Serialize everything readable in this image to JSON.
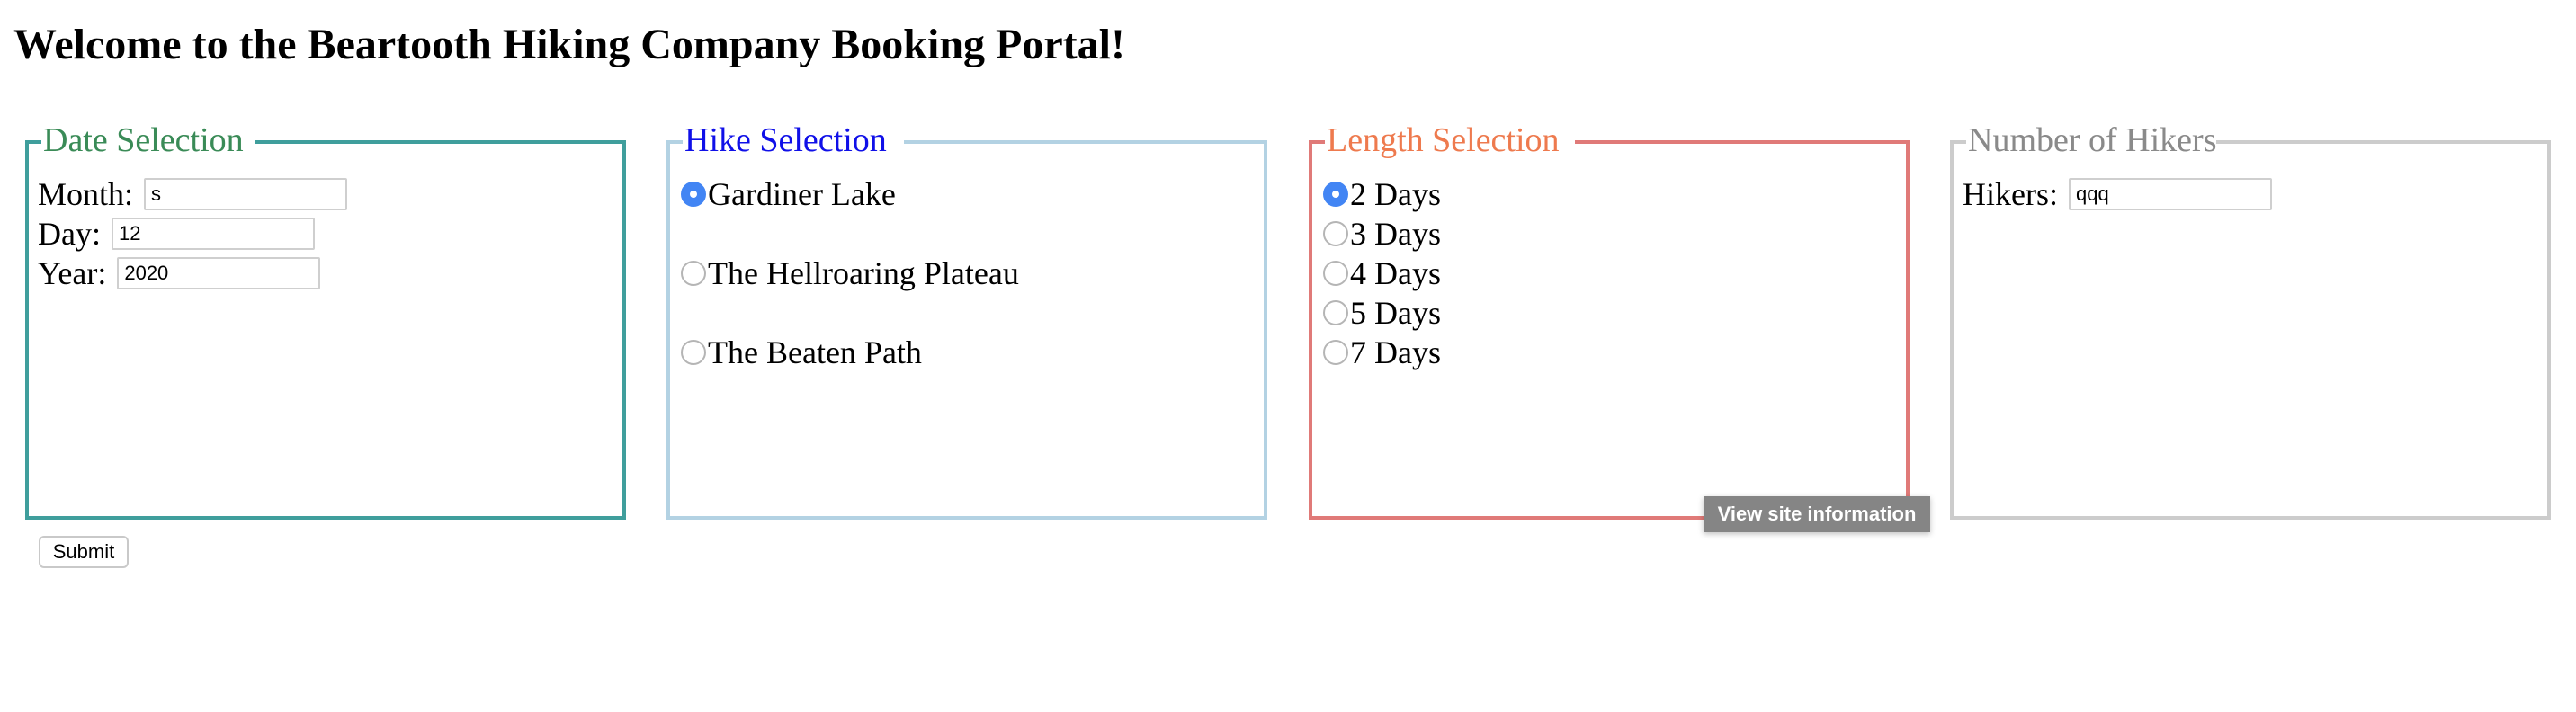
{
  "heading": "Welcome to the Beartooth Hiking Company Booking Portal!",
  "date_selection": {
    "legend": "Date Selection",
    "month": {
      "label": "Month:",
      "value": "s"
    },
    "day": {
      "label": "Day:",
      "value": "12"
    },
    "year": {
      "label": "Year:",
      "value": "2020"
    }
  },
  "hike_selection": {
    "legend": "Hike Selection",
    "options": [
      {
        "label": "Gardiner Lake",
        "checked": true
      },
      {
        "label": "The Hellroaring Plateau",
        "checked": false
      },
      {
        "label": "The Beaten Path",
        "checked": false
      }
    ]
  },
  "length_selection": {
    "legend": "Length Selection",
    "options": [
      {
        "label": "2 Days",
        "checked": true
      },
      {
        "label": "3 Days",
        "checked": false
      },
      {
        "label": "4 Days",
        "checked": false
      },
      {
        "label": "5 Days",
        "checked": false
      },
      {
        "label": "7 Days",
        "checked": false
      }
    ]
  },
  "number_of_hikers": {
    "legend": "Number of Hikers",
    "hikers": {
      "label": "Hikers:",
      "value": "qqq"
    }
  },
  "submit_label": "Submit",
  "tooltip": "View site information",
  "colors": {
    "date_border": "#3f9e9c",
    "date_legend": "#3a8b57",
    "hike_border": "#b3d2e3",
    "hike_legend": "#1010e8",
    "length_border": "#e07a78",
    "length_legend": "#ee7a4e",
    "hikers_border": "#cccccc",
    "hikers_legend": "#8a8a8a",
    "radio_checked": "#4285f4"
  }
}
